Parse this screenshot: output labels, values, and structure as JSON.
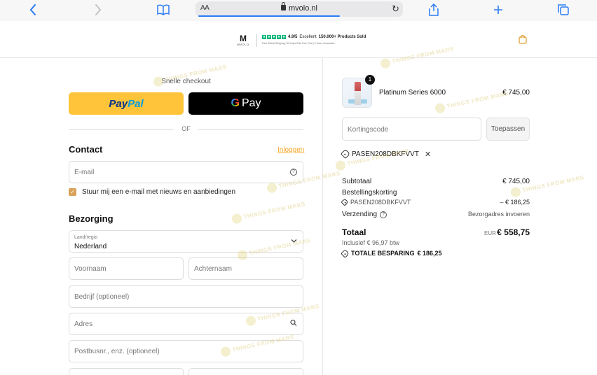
{
  "browser": {
    "text_size_label": "AA",
    "url": "mvolo.nl"
  },
  "header": {
    "logo_text": "M",
    "logo_sub": "MVOLO",
    "rating": "4.9/5",
    "rating_word": "Excellent",
    "products_sold": "150.000+ Products Sold",
    "benefits": "Fast Global Shipping  |  30 Days Risk Free Trial  |  2 Years Guarantee",
    "brand_color": "#00b67a"
  },
  "checkout": {
    "quick_title": "Snelle checkout",
    "paypal_pay": "Pay",
    "paypal_pal": "Pal",
    "gpay_g": "G",
    "gpay_label": "Pay",
    "or_text": "OF"
  },
  "contact": {
    "title": "Contact",
    "login_link": "Inloggen",
    "email_placeholder": "E-mail",
    "newsletter_label": "Stuur mij een e-mail met nieuws en aanbiedingen",
    "newsletter_checked": true
  },
  "delivery": {
    "title": "Bezorging",
    "country_label": "Land/regio",
    "country_value": "Nederland",
    "first_name_placeholder": "Voornaam",
    "last_name_placeholder": "Achternaam",
    "company_placeholder": "Bedrijf (optioneel)",
    "address_placeholder": "Adres",
    "address2_placeholder": "Postbusnr., enz. (optioneel)"
  },
  "order": {
    "quantity": "1",
    "product_name": "Platinum Series 6000",
    "product_price": "€ 745,00",
    "discount_placeholder": "Kortingscode",
    "apply_label": "Toepassen",
    "applied_code": "PASEN208DBKFVVT",
    "subtotal_label": "Subtotaal",
    "subtotal_value": "€ 745,00",
    "discount_label": "Bestellingskorting",
    "discount_code": "PASEN208DBKFVVT",
    "discount_value": "– € 186,25",
    "shipping_label": "Verzending",
    "shipping_value": "Bezorgadres invoeren",
    "total_label": "Totaal",
    "total_currency": "EUR",
    "total_value": "€ 558,75",
    "tax_note": "Inclusief € 96,97 btw",
    "savings_label": "TOTALE BESPARING",
    "savings_value": "€ 186,25"
  },
  "watermark_text": "THINGS FROM MARS"
}
